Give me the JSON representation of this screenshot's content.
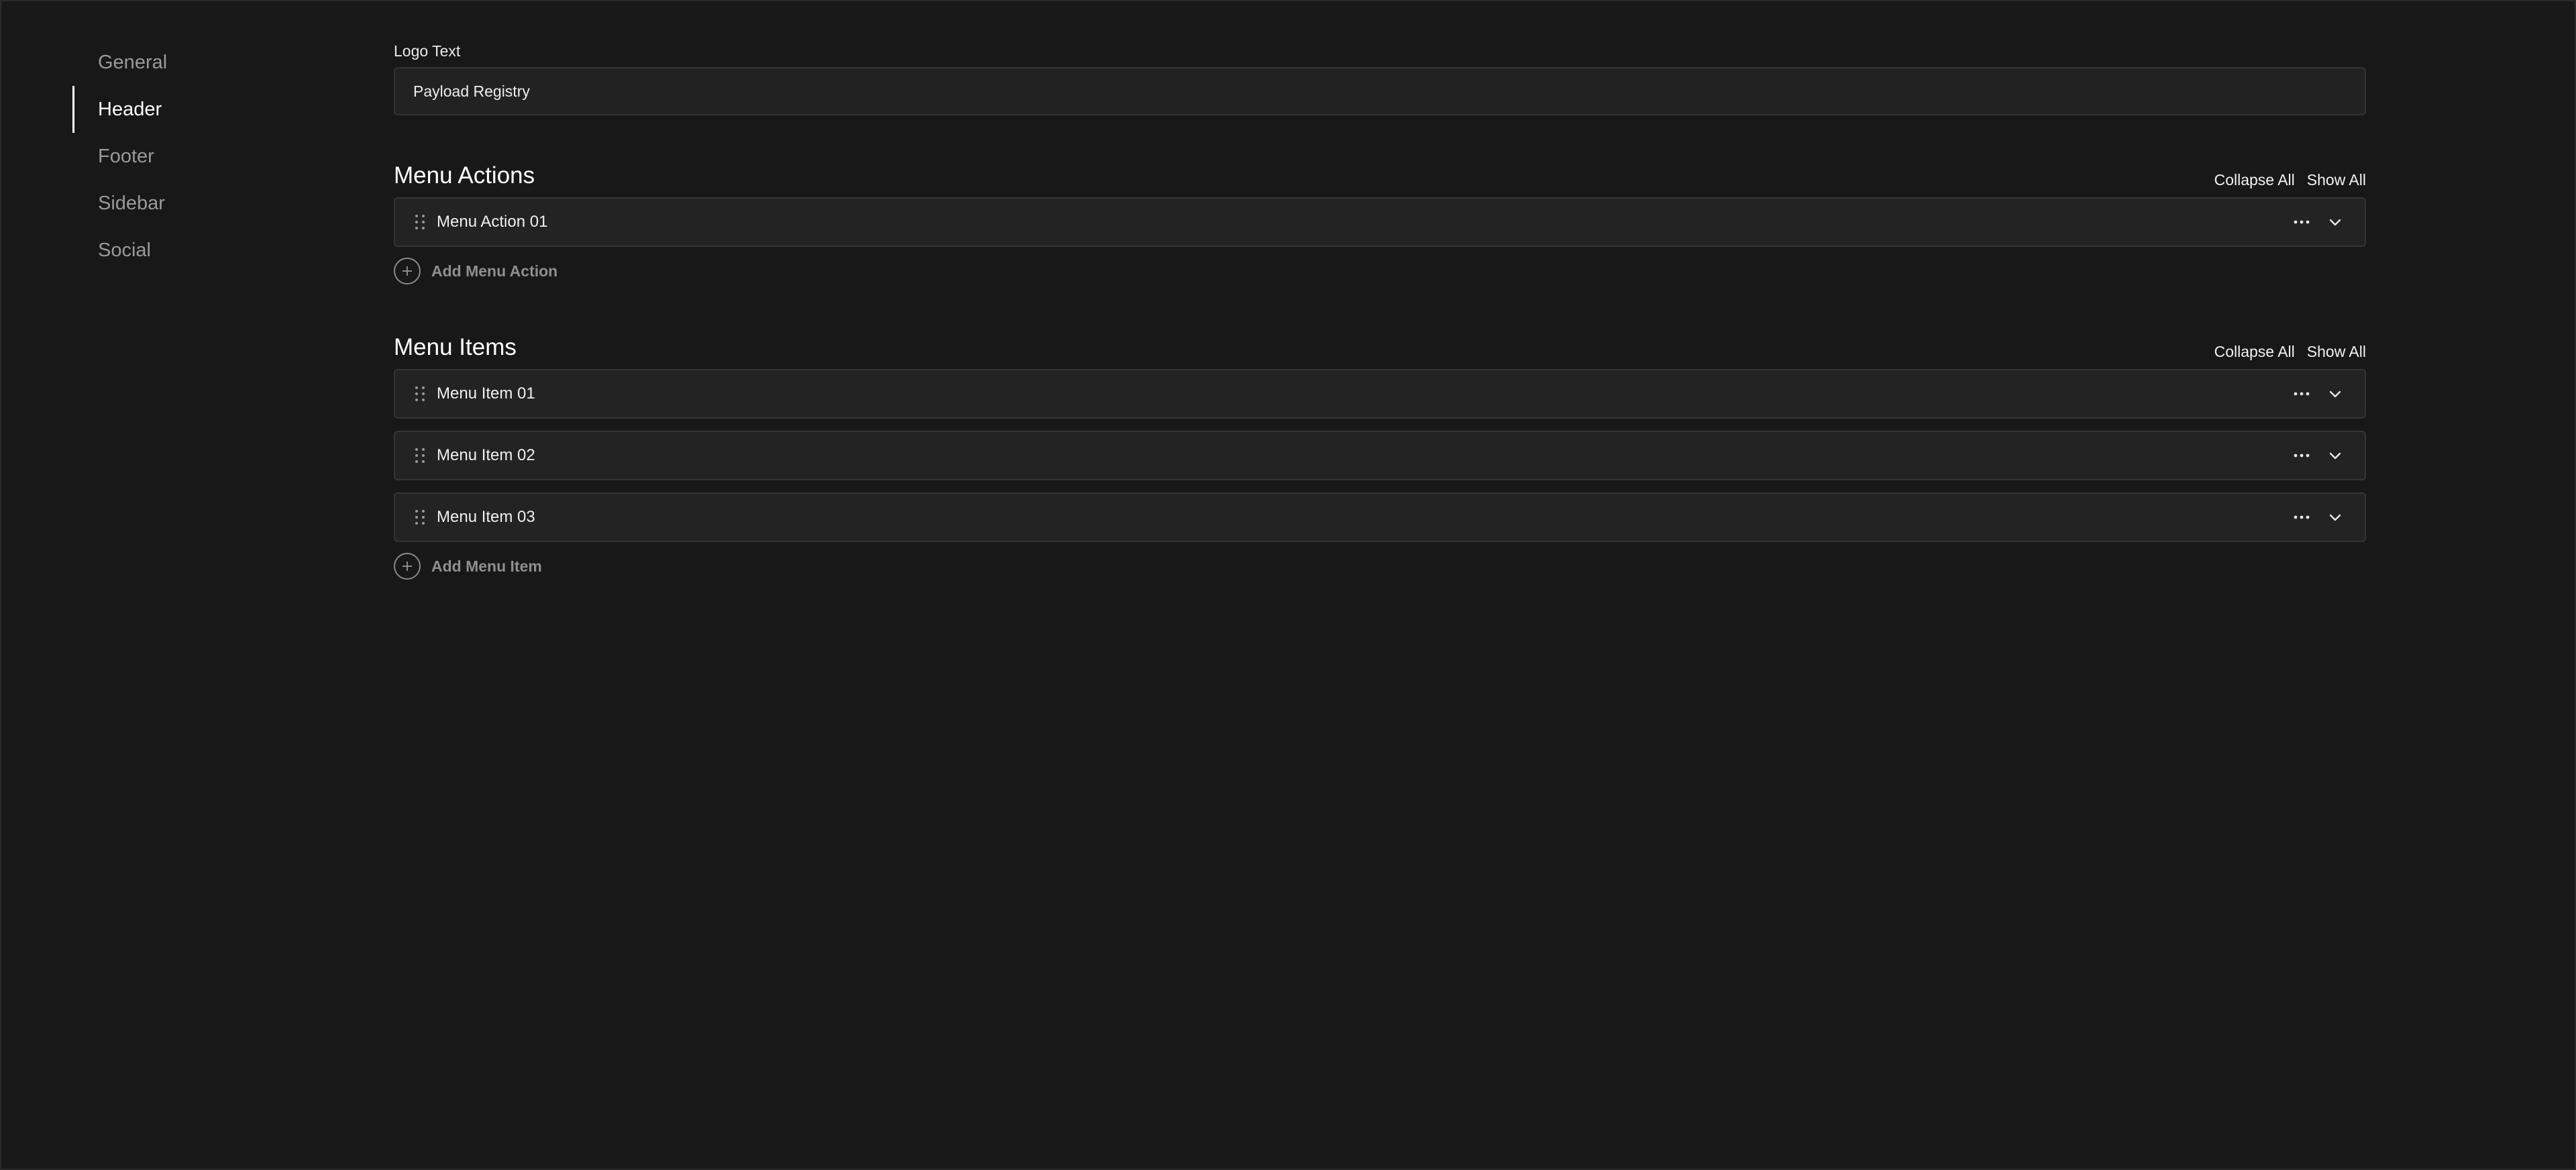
{
  "nav": {
    "items": [
      {
        "label": "General",
        "active": false
      },
      {
        "label": "Header",
        "active": true
      },
      {
        "label": "Footer",
        "active": false
      },
      {
        "label": "Sidebar",
        "active": false
      },
      {
        "label": "Social",
        "active": false
      }
    ]
  },
  "logo_field": {
    "label": "Logo Text",
    "value": "Payload Registry"
  },
  "menu_actions": {
    "title": "Menu Actions",
    "collapse_all": "Collapse All",
    "show_all": "Show All",
    "rows": [
      "Menu Action 01"
    ],
    "add_label": "Add Menu Action"
  },
  "menu_items": {
    "title": "Menu Items",
    "collapse_all": "Collapse All",
    "show_all": "Show All",
    "rows": [
      "Menu Item 01",
      "Menu Item 02",
      "Menu Item 03"
    ],
    "add_label": "Add Menu Item"
  },
  "icons": {
    "drag": "drag-handle-icon",
    "more": "more-horizontal-icon",
    "expand": "chevron-down-icon",
    "add": "plus-circle-icon"
  }
}
